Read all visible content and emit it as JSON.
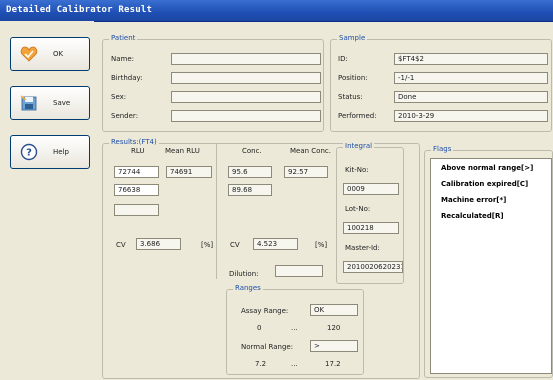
{
  "window": {
    "title": "Detailed Calibrator Result"
  },
  "buttons": {
    "ok": "OK",
    "save": "Save",
    "help": "Help"
  },
  "patient": {
    "title": "Patient",
    "name_label": "Name:",
    "name": "",
    "birthday_label": "Birthday:",
    "birthday": "",
    "sex_label": "Sex:",
    "sex": "",
    "sender_label": "Sender:",
    "sender": ""
  },
  "sample": {
    "title": "Sample",
    "id_label": "ID:",
    "id": "$FT4$2",
    "position_label": "Position:",
    "position": "-1/-1",
    "status_label": "Status:",
    "status": "Done",
    "performed_label": "Performed:",
    "performed": "2010-3-29"
  },
  "results": {
    "title": "Results:(FT4)",
    "rlu_header": "RLU",
    "mean_rlu_header": "Mean RLU",
    "rlu_values": [
      "72744",
      "76638",
      ""
    ],
    "mean_rlu": "74691",
    "cv_label": "CV",
    "cv_rlu": "3.686",
    "percent": "[%]",
    "conc_header": "Conc.",
    "mean_conc_header": "Mean Conc.",
    "conc_values": [
      "95.6",
      "89.68"
    ],
    "mean_conc": "92.57",
    "cv_conc": "4.523",
    "dilution_label": "Dilution:",
    "dilution": ""
  },
  "integral": {
    "title": "Integral",
    "kit_label": "Kit-No:",
    "kit": "0009",
    "lot_label": "Lot-No:",
    "lot": "100218",
    "master_label": "Master-Id:",
    "master": "20100206202310"
  },
  "ranges": {
    "title": "Ranges",
    "assay_label": "Assay Range:",
    "assay_status": "OK",
    "assay_low": "0",
    "dots": "...",
    "assay_high": "120",
    "normal_label": "Normal Range:",
    "normal_status": ">",
    "normal_low": "7.2",
    "normal_high": "17.2"
  },
  "flags": {
    "title": "Flags",
    "items": [
      "Above normal range[>]",
      "Calibration expired[C]",
      "Machine error[*]",
      "Recalculated[R]"
    ]
  }
}
